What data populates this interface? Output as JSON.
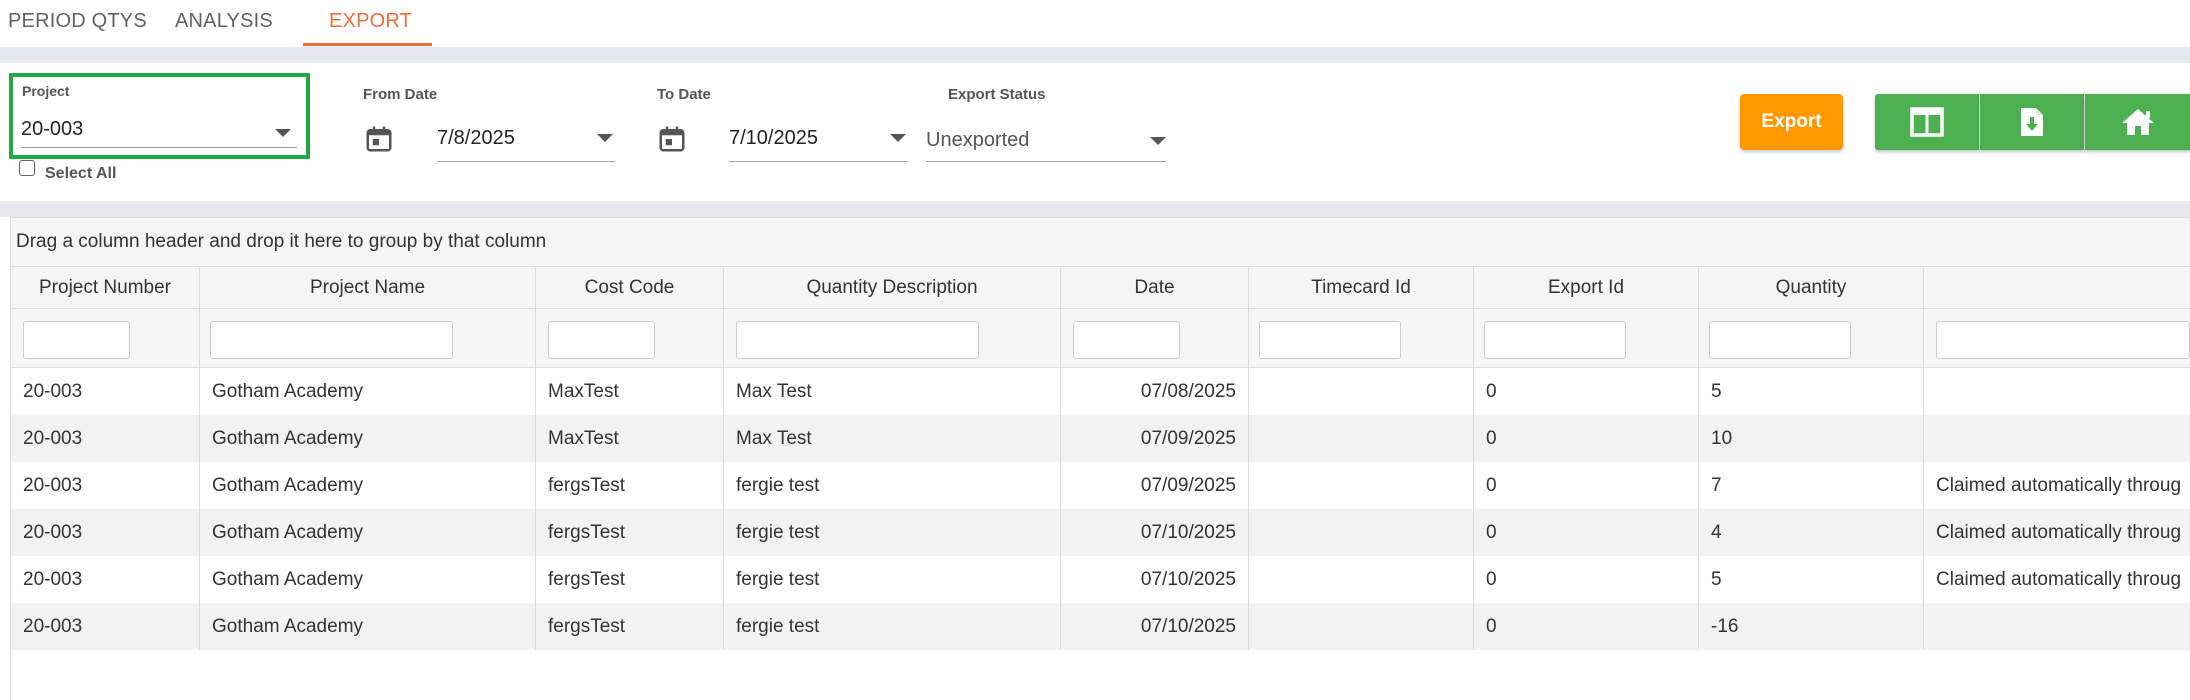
{
  "tabs": [
    {
      "label": "PERIOD QTYS"
    },
    {
      "label": "ANALYSIS"
    },
    {
      "label": "EXPORT",
      "active": true
    }
  ],
  "filters": {
    "project_label": "Project",
    "project_value": "20-003",
    "from_label": "From Date",
    "from_value": "7/8/2025",
    "to_label": "To Date",
    "to_value": "7/10/2025",
    "status_label": "Export Status",
    "status_value": "Unexported",
    "select_all_label": "Select All"
  },
  "buttons": {
    "export_label": "Export",
    "icons": [
      "columns-icon",
      "file-download-icon",
      "home-icon"
    ]
  },
  "colors": {
    "accent": "#f26b3a",
    "export_button": "#ff9800",
    "green_buttons": "#4caf50",
    "highlight_border": "#22a843"
  },
  "grid": {
    "group_panel_text": "Drag a column header and drop it here to group by that column",
    "columns": [
      "Project Number",
      "Project Name",
      "Cost Code",
      "Quantity Description",
      "Date",
      "Timecard Id",
      "Export Id",
      "Quantity",
      ""
    ],
    "rows": [
      [
        "20-003",
        "Gotham Academy",
        "MaxTest",
        "Max Test",
        "07/08/2025",
        "",
        "0",
        "5",
        ""
      ],
      [
        "20-003",
        "Gotham Academy",
        "MaxTest",
        "Max Test",
        "07/09/2025",
        "",
        "0",
        "10",
        ""
      ],
      [
        "20-003",
        "Gotham Academy",
        "fergsTest",
        "fergie test",
        "07/09/2025",
        "",
        "0",
        "7",
        "Claimed automatically throug"
      ],
      [
        "20-003",
        "Gotham Academy",
        "fergsTest",
        "fergie test",
        "07/10/2025",
        "",
        "0",
        "4",
        "Claimed automatically throug"
      ],
      [
        "20-003",
        "Gotham Academy",
        "fergsTest",
        "fergie test",
        "07/10/2025",
        "",
        "0",
        "5",
        "Claimed automatically throug"
      ],
      [
        "20-003",
        "Gotham Academy",
        "fergsTest",
        "fergie test",
        "07/10/2025",
        "",
        "0",
        "-16",
        ""
      ]
    ]
  }
}
